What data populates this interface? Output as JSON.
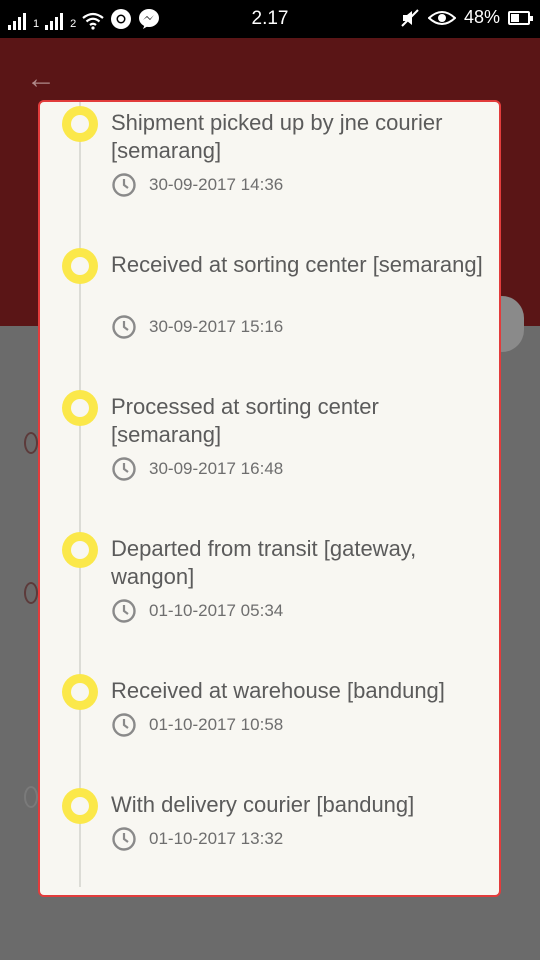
{
  "status_bar": {
    "sim1": "1",
    "sim2": "2",
    "time": "2.17",
    "battery": "48%",
    "icons": [
      "signal-icon",
      "wifi-icon",
      "chrome-icon",
      "messenger-icon",
      "mute-icon",
      "eye-icon",
      "battery-icon"
    ]
  },
  "events": [
    {
      "title": "Shipment picked up by jne courier [semarang]",
      "time": "30-09-2017 14:36"
    },
    {
      "title": "Received at sorting center [semarang]",
      "time": "30-09-2017 15:16"
    },
    {
      "title": "Processed at sorting center [semarang]",
      "time": "30-09-2017 16:48"
    },
    {
      "title": "Departed from transit [gateway, wangon]",
      "time": "01-10-2017 05:34"
    },
    {
      "title": "Received at warehouse [bandung]",
      "time": "01-10-2017 10:58"
    },
    {
      "title": "With delivery courier [bandung]",
      "time": "01-10-2017 13:32"
    }
  ],
  "colors": {
    "accent_dot": "#fbe84a",
    "dialog_border": "#e23c3c",
    "header": "#5a1516"
  }
}
